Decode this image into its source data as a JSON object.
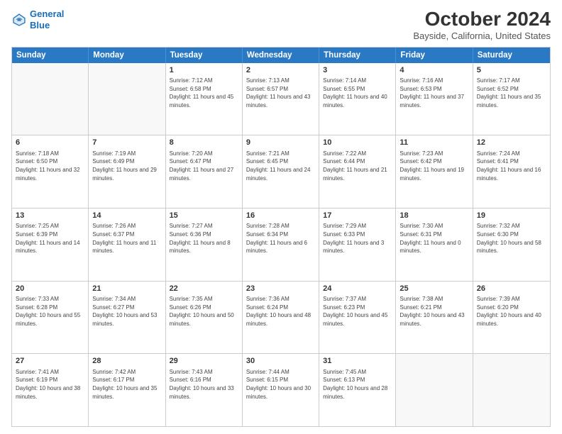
{
  "header": {
    "logo_line1": "General",
    "logo_line2": "Blue",
    "month_title": "October 2024",
    "subtitle": "Bayside, California, United States"
  },
  "weekdays": [
    "Sunday",
    "Monday",
    "Tuesday",
    "Wednesday",
    "Thursday",
    "Friday",
    "Saturday"
  ],
  "rows": [
    [
      {
        "day": "",
        "sunrise": "",
        "sunset": "",
        "daylight": ""
      },
      {
        "day": "",
        "sunrise": "",
        "sunset": "",
        "daylight": ""
      },
      {
        "day": "1",
        "sunrise": "Sunrise: 7:12 AM",
        "sunset": "Sunset: 6:58 PM",
        "daylight": "Daylight: 11 hours and 45 minutes."
      },
      {
        "day": "2",
        "sunrise": "Sunrise: 7:13 AM",
        "sunset": "Sunset: 6:57 PM",
        "daylight": "Daylight: 11 hours and 43 minutes."
      },
      {
        "day": "3",
        "sunrise": "Sunrise: 7:14 AM",
        "sunset": "Sunset: 6:55 PM",
        "daylight": "Daylight: 11 hours and 40 minutes."
      },
      {
        "day": "4",
        "sunrise": "Sunrise: 7:16 AM",
        "sunset": "Sunset: 6:53 PM",
        "daylight": "Daylight: 11 hours and 37 minutes."
      },
      {
        "day": "5",
        "sunrise": "Sunrise: 7:17 AM",
        "sunset": "Sunset: 6:52 PM",
        "daylight": "Daylight: 11 hours and 35 minutes."
      }
    ],
    [
      {
        "day": "6",
        "sunrise": "Sunrise: 7:18 AM",
        "sunset": "Sunset: 6:50 PM",
        "daylight": "Daylight: 11 hours and 32 minutes."
      },
      {
        "day": "7",
        "sunrise": "Sunrise: 7:19 AM",
        "sunset": "Sunset: 6:49 PM",
        "daylight": "Daylight: 11 hours and 29 minutes."
      },
      {
        "day": "8",
        "sunrise": "Sunrise: 7:20 AM",
        "sunset": "Sunset: 6:47 PM",
        "daylight": "Daylight: 11 hours and 27 minutes."
      },
      {
        "day": "9",
        "sunrise": "Sunrise: 7:21 AM",
        "sunset": "Sunset: 6:45 PM",
        "daylight": "Daylight: 11 hours and 24 minutes."
      },
      {
        "day": "10",
        "sunrise": "Sunrise: 7:22 AM",
        "sunset": "Sunset: 6:44 PM",
        "daylight": "Daylight: 11 hours and 21 minutes."
      },
      {
        "day": "11",
        "sunrise": "Sunrise: 7:23 AM",
        "sunset": "Sunset: 6:42 PM",
        "daylight": "Daylight: 11 hours and 19 minutes."
      },
      {
        "day": "12",
        "sunrise": "Sunrise: 7:24 AM",
        "sunset": "Sunset: 6:41 PM",
        "daylight": "Daylight: 11 hours and 16 minutes."
      }
    ],
    [
      {
        "day": "13",
        "sunrise": "Sunrise: 7:25 AM",
        "sunset": "Sunset: 6:39 PM",
        "daylight": "Daylight: 11 hours and 14 minutes."
      },
      {
        "day": "14",
        "sunrise": "Sunrise: 7:26 AM",
        "sunset": "Sunset: 6:37 PM",
        "daylight": "Daylight: 11 hours and 11 minutes."
      },
      {
        "day": "15",
        "sunrise": "Sunrise: 7:27 AM",
        "sunset": "Sunset: 6:36 PM",
        "daylight": "Daylight: 11 hours and 8 minutes."
      },
      {
        "day": "16",
        "sunrise": "Sunrise: 7:28 AM",
        "sunset": "Sunset: 6:34 PM",
        "daylight": "Daylight: 11 hours and 6 minutes."
      },
      {
        "day": "17",
        "sunrise": "Sunrise: 7:29 AM",
        "sunset": "Sunset: 6:33 PM",
        "daylight": "Daylight: 11 hours and 3 minutes."
      },
      {
        "day": "18",
        "sunrise": "Sunrise: 7:30 AM",
        "sunset": "Sunset: 6:31 PM",
        "daylight": "Daylight: 11 hours and 0 minutes."
      },
      {
        "day": "19",
        "sunrise": "Sunrise: 7:32 AM",
        "sunset": "Sunset: 6:30 PM",
        "daylight": "Daylight: 10 hours and 58 minutes."
      }
    ],
    [
      {
        "day": "20",
        "sunrise": "Sunrise: 7:33 AM",
        "sunset": "Sunset: 6:28 PM",
        "daylight": "Daylight: 10 hours and 55 minutes."
      },
      {
        "day": "21",
        "sunrise": "Sunrise: 7:34 AM",
        "sunset": "Sunset: 6:27 PM",
        "daylight": "Daylight: 10 hours and 53 minutes."
      },
      {
        "day": "22",
        "sunrise": "Sunrise: 7:35 AM",
        "sunset": "Sunset: 6:26 PM",
        "daylight": "Daylight: 10 hours and 50 minutes."
      },
      {
        "day": "23",
        "sunrise": "Sunrise: 7:36 AM",
        "sunset": "Sunset: 6:24 PM",
        "daylight": "Daylight: 10 hours and 48 minutes."
      },
      {
        "day": "24",
        "sunrise": "Sunrise: 7:37 AM",
        "sunset": "Sunset: 6:23 PM",
        "daylight": "Daylight: 10 hours and 45 minutes."
      },
      {
        "day": "25",
        "sunrise": "Sunrise: 7:38 AM",
        "sunset": "Sunset: 6:21 PM",
        "daylight": "Daylight: 10 hours and 43 minutes."
      },
      {
        "day": "26",
        "sunrise": "Sunrise: 7:39 AM",
        "sunset": "Sunset: 6:20 PM",
        "daylight": "Daylight: 10 hours and 40 minutes."
      }
    ],
    [
      {
        "day": "27",
        "sunrise": "Sunrise: 7:41 AM",
        "sunset": "Sunset: 6:19 PM",
        "daylight": "Daylight: 10 hours and 38 minutes."
      },
      {
        "day": "28",
        "sunrise": "Sunrise: 7:42 AM",
        "sunset": "Sunset: 6:17 PM",
        "daylight": "Daylight: 10 hours and 35 minutes."
      },
      {
        "day": "29",
        "sunrise": "Sunrise: 7:43 AM",
        "sunset": "Sunset: 6:16 PM",
        "daylight": "Daylight: 10 hours and 33 minutes."
      },
      {
        "day": "30",
        "sunrise": "Sunrise: 7:44 AM",
        "sunset": "Sunset: 6:15 PM",
        "daylight": "Daylight: 10 hours and 30 minutes."
      },
      {
        "day": "31",
        "sunrise": "Sunrise: 7:45 AM",
        "sunset": "Sunset: 6:13 PM",
        "daylight": "Daylight: 10 hours and 28 minutes."
      },
      {
        "day": "",
        "sunrise": "",
        "sunset": "",
        "daylight": ""
      },
      {
        "day": "",
        "sunrise": "",
        "sunset": "",
        "daylight": ""
      }
    ]
  ]
}
